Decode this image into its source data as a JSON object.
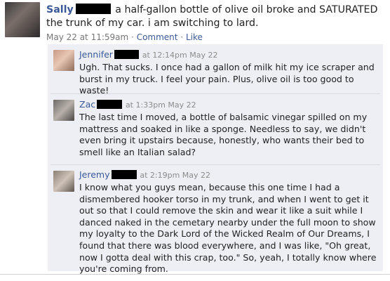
{
  "post": {
    "author": "Sally",
    "text": "a half-gallon bottle of olive oil broke and SATURATED the trunk of my car. i am switching to lard.",
    "timestamp": "May 22 at 11:59am",
    "separator": "·",
    "comment_link": "Comment",
    "like_link": "Like"
  },
  "comments": [
    {
      "author": "Jennifer",
      "time": "at 12:14pm May 22",
      "text": "Ugh. That sucks. I once had a gallon of milk hit my ice scraper and burst in my truck. I feel your pain. Plus, olive oil is too good to waste!"
    },
    {
      "author": "Zac",
      "time": "at 1:33pm May 22",
      "text": "The last time I moved, a bottle of balsamic vinegar spilled on my mattress and soaked in like a sponge. Needless to say, we didn't even bring it upstairs because, honestly, who wants their bed to smell like an Italian salad?"
    },
    {
      "author": "Jeremy",
      "time": "at 2:19pm May 22",
      "text": "I know what you guys mean, because this one time I had a dismembered hooker torso in my trunk, and when I went to get it out so that I could remove the skin and wear it like a suit while I danced naked in the cemetary nearby under the full moon to show my loyalty to the Dark Lord of the Wicked Realm of Our Dreams, I found that there was blood everywhere, and I was like, \"Oh great, now I gotta deal with this crap, too.\" So, yeah, I totally know where you're coming from."
    }
  ],
  "colors": {
    "link_blue": "#3b5998",
    "comment_bg": "#edeff4",
    "meta_gray": "#777777",
    "redaction": "#000000"
  },
  "icons": {
    "main_avatar": "profile-photo",
    "comment_avatars": [
      "profile-photo",
      "profile-photo",
      "profile-photo"
    ]
  }
}
